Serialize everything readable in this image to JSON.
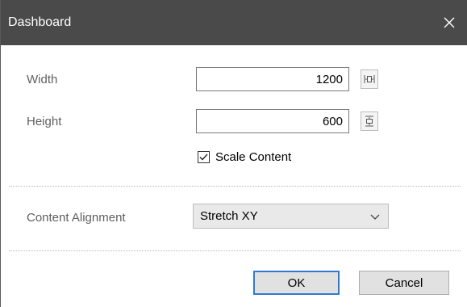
{
  "window": {
    "title": "Dashboard"
  },
  "fields": {
    "width": {
      "label": "Width",
      "value": "1200"
    },
    "height": {
      "label": "Height",
      "value": "600"
    }
  },
  "scale_content": {
    "label": "Scale Content",
    "checked": true
  },
  "content_alignment": {
    "label": "Content Alignment",
    "selected": "Stretch XY"
  },
  "buttons": {
    "ok": "OK",
    "cancel": "Cancel"
  },
  "colors": {
    "titlebar": "#4a4a4a",
    "accent": "#2f7bd0"
  },
  "icons": {
    "close": "close-icon",
    "fit_width": "fit-width-icon",
    "fit_height": "fit-height-icon",
    "checkmark": "checkmark-icon",
    "dropdown": "chevron-down-icon"
  }
}
